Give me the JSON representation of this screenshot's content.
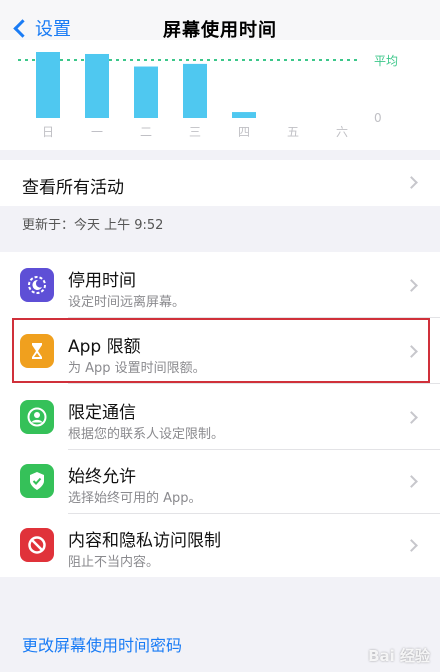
{
  "nav": {
    "back_label": "设置",
    "title": "屏幕使用时间"
  },
  "chart_data": {
    "type": "bar",
    "categories": [
      "日",
      "一",
      "二",
      "三",
      "四",
      "五",
      "六"
    ],
    "values": [
      1.0,
      0.97,
      0.78,
      0.82,
      0.09,
      0,
      0
    ],
    "avg_label": "平均",
    "zero_label": "0",
    "bar_color": "#4fc8f0",
    "avg_line_color": "#3cc78a"
  },
  "activity": {
    "label": "查看所有活动"
  },
  "updated": {
    "text": "更新于：今天 上午 9:52"
  },
  "items": [
    {
      "title": "停用时间",
      "subtitle": "设定时间远离屏幕。",
      "icon": "moon-icon",
      "color": "#5e4fd6"
    },
    {
      "title": "App 限额",
      "subtitle": "为 App 设置时间限额。",
      "icon": "hourglass-icon",
      "color": "#f0a01e"
    },
    {
      "title": "限定通信",
      "subtitle": "根据您的联系人设定限制。",
      "icon": "person-icon",
      "color": "#35c159"
    },
    {
      "title": "始终允许",
      "subtitle": "选择始终可用的 App。",
      "icon": "checkmark-icon",
      "color": "#35c159"
    },
    {
      "title": "内容和隐私访问限制",
      "subtitle": "阻止不当内容。",
      "icon": "no-entry-icon",
      "color": "#e0323a"
    }
  ],
  "footer": {
    "change_passcode": "更改屏幕使用时间密码"
  },
  "watermark": "Bai 经验"
}
